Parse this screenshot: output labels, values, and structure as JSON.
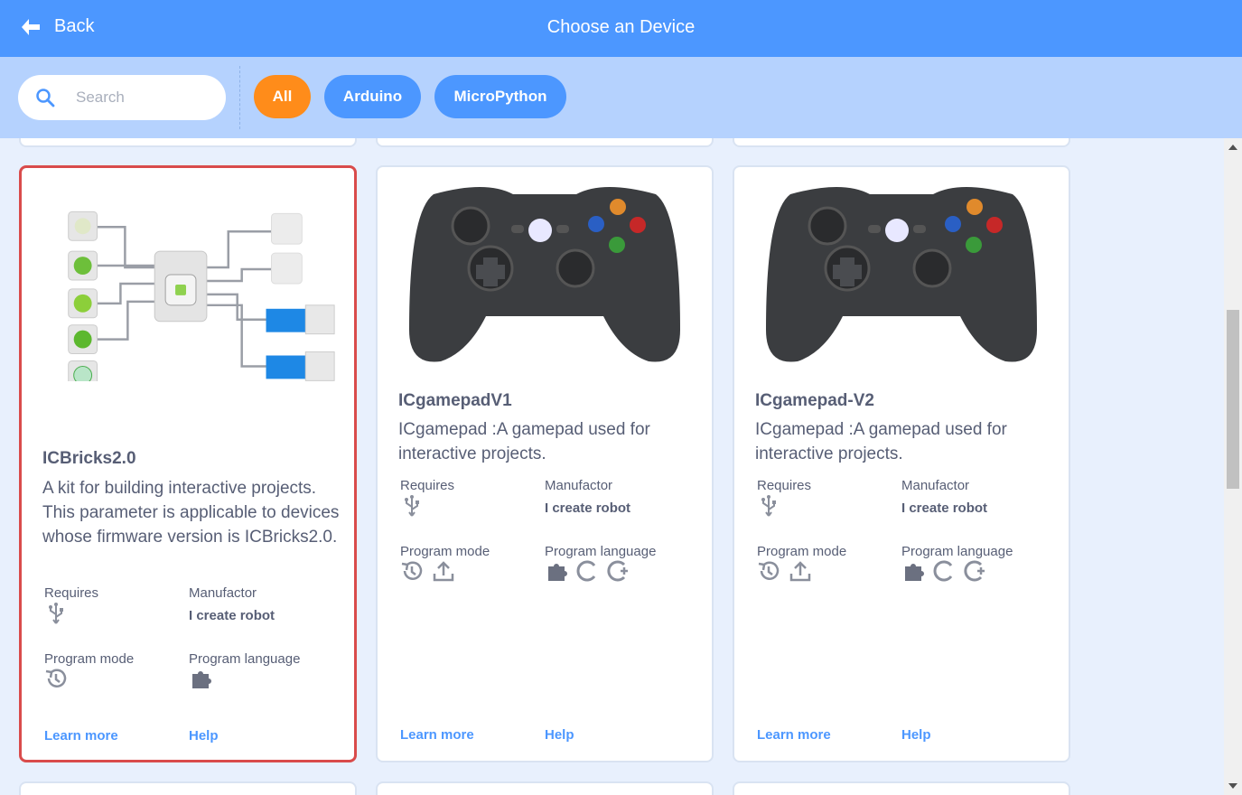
{
  "header": {
    "back_label": "Back",
    "title": "Choose an Device"
  },
  "filters": {
    "search_placeholder": "Search",
    "tabs": [
      {
        "label": "All",
        "active": true,
        "color": "#ff8c1a"
      },
      {
        "label": "Arduino",
        "active": false,
        "color": "#4c97ff"
      },
      {
        "label": "MicroPython",
        "active": false,
        "color": "#4c97ff"
      }
    ]
  },
  "labels": {
    "requires": "Requires",
    "manufactor": "Manufactor",
    "program_mode": "Program mode",
    "program_language": "Program language",
    "learn_more": "Learn more",
    "help": "Help"
  },
  "devices": [
    {
      "name": "ICBricks2.0",
      "description": "A kit for building interactive projects. This parameter is applicable to devices whose firmware version is ICBricks2.0.",
      "manufactor": "I create robot",
      "requires": [
        "usb-icon"
      ],
      "program_modes": [
        "realtime-icon"
      ],
      "program_languages": [
        "blocks-icon"
      ],
      "selected": true
    },
    {
      "name": "ICgamepadV1",
      "description": "ICgamepad :A gamepad used for interactive projects.",
      "manufactor": "I create robot",
      "requires": [
        "usb-icon"
      ],
      "program_modes": [
        "realtime-icon",
        "upload-icon"
      ],
      "program_languages": [
        "blocks-icon",
        "c-icon",
        "cpp-icon"
      ],
      "selected": false
    },
    {
      "name": "ICgamepad-V2",
      "description": "ICgamepad :A gamepad used for interactive projects.",
      "manufactor": "I create robot",
      "requires": [
        "usb-icon"
      ],
      "program_modes": [
        "realtime-icon",
        "upload-icon"
      ],
      "program_languages": [
        "blocks-icon",
        "c-icon",
        "cpp-icon"
      ],
      "selected": false
    }
  ],
  "colors": {
    "primary": "#4c97ff",
    "filter_bar": "#b5d2fe",
    "active_tab": "#ff8c1a",
    "selected_border": "#d94b4b",
    "text": "#575e75"
  }
}
